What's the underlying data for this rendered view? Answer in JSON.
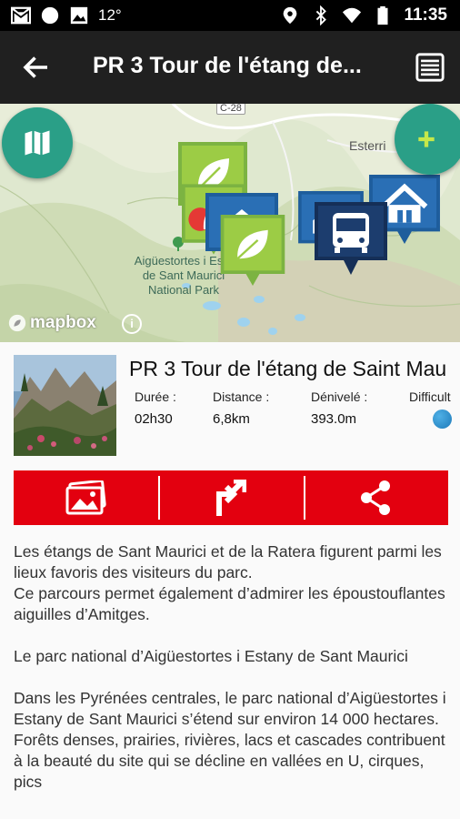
{
  "status_bar": {
    "temperature": "12°",
    "time": "11:35",
    "icons": [
      "gmail-icon",
      "circle-notification-icon",
      "image-notification-icon",
      "location-icon",
      "bluetooth-icon",
      "wifi-icon",
      "battery-icon"
    ]
  },
  "app_bar": {
    "title": "PR 3 Tour de l'étang de...",
    "icons": [
      "back-arrow-icon",
      "list-icon"
    ]
  },
  "map": {
    "park_label": "Aigüestortes i Estany de Sant Maurici National Park",
    "park_label_lines": [
      "Aigüestortes i Esta",
      "de Sant Maurici",
      "National Park"
    ],
    "town_label": "Esterri",
    "road_label": "C-28",
    "attribution": "mapbox",
    "icons": [
      "map-icon",
      "plus-icon",
      "leaf-marker-icon",
      "house-marker-icon",
      "bus-marker-icon",
      "info-icon"
    ],
    "colors": {
      "fab": "#2a9f87",
      "leaf_marker": "#8bc34a",
      "house_marker": "#1e5d9c",
      "bus_marker": "#1c3d6e"
    }
  },
  "trail": {
    "title": "PR 3 Tour de l'étang de Saint Mau",
    "stats": [
      {
        "label": "Durée :",
        "value": "02h30"
      },
      {
        "label": "Distance :",
        "value": "6,8km"
      },
      {
        "label": "Dénivelé :",
        "value": "393.0m"
      },
      {
        "label": "Difficult",
        "value": ""
      }
    ],
    "difficulty_color": "#1e7ab9"
  },
  "actions": {
    "color": "#e3000f",
    "items": [
      {
        "icon": "gallery-icon"
      },
      {
        "icon": "directions-icon"
      },
      {
        "icon": "share-icon"
      }
    ]
  },
  "description": {
    "paragraphs": [
      "Les étangs de Sant Maurici et de la Ratera figurent parmi les lieux favoris des visiteurs du parc.\nCe parcours permet également d’admirer les époustouflantes aiguilles d’Amitges.",
      "Le parc national d’Aigüestortes i Estany de Sant Maurici",
      "Dans les Pyrénées centrales, le parc national d’Aigüestortes i Estany de Sant Maurici s’étend sur environ 14 000 hectares. Forêts denses, prairies, rivières, lacs et cascades contribuent à la beauté du site qui se décline en vallées en U, cirques, pics"
    ]
  }
}
